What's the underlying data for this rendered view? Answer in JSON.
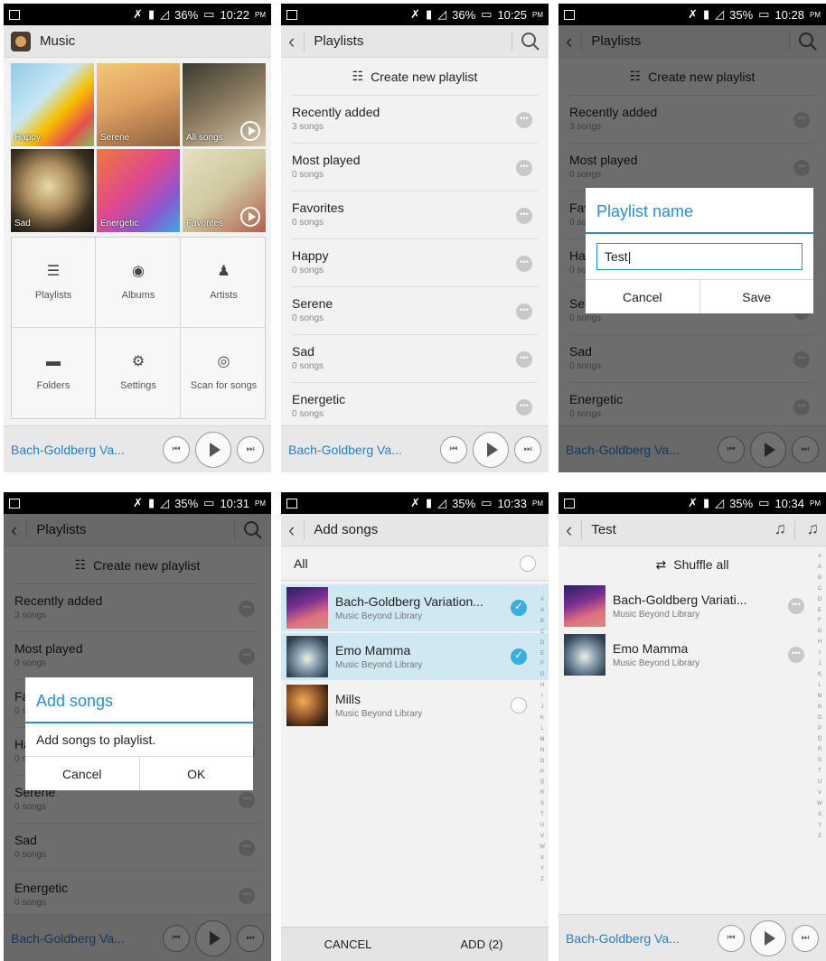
{
  "status": {
    "s1": {
      "battery": "36%",
      "time": "10:22",
      "ampm": "PM"
    },
    "s2": {
      "battery": "36%",
      "time": "10:25",
      "ampm": "PM"
    },
    "s3": {
      "battery": "35%",
      "time": "10:28",
      "ampm": "PM"
    },
    "s4": {
      "battery": "35%",
      "time": "10:31",
      "ampm": "PM"
    },
    "s5": {
      "battery": "35%",
      "time": "10:33",
      "ampm": "PM"
    },
    "s6": {
      "battery": "35%",
      "time": "10:34",
      "ampm": "PM"
    }
  },
  "home": {
    "title": "Music",
    "tiles": [
      "Happy",
      "Serene",
      "All songs",
      "Sad",
      "Energetic",
      "Favorites"
    ],
    "nav": [
      "Playlists",
      "Albums",
      "Artists",
      "Folders",
      "Settings",
      "Scan for songs"
    ]
  },
  "player": {
    "now_playing": "Bach-Goldberg Va..."
  },
  "playlists": {
    "title": "Playlists",
    "create": "Create new playlist",
    "items": [
      {
        "name": "Recently added",
        "count": "3 songs"
      },
      {
        "name": "Most played",
        "count": "0 songs"
      },
      {
        "name": "Favorites",
        "count": "0 songs"
      },
      {
        "name": "Happy",
        "count": "0 songs"
      },
      {
        "name": "Serene",
        "count": "0 songs"
      },
      {
        "name": "Sad",
        "count": "0 songs"
      },
      {
        "name": "Energetic",
        "count": "0 songs"
      }
    ]
  },
  "dialog_name": {
    "title": "Playlist name",
    "value": "Test",
    "cancel": "Cancel",
    "save": "Save"
  },
  "dialog_add": {
    "title": "Add songs",
    "body": "Add songs to playlist.",
    "cancel": "Cancel",
    "ok": "OK"
  },
  "add_songs": {
    "title": "Add songs",
    "all": "All",
    "songs": [
      {
        "title": "Bach-Goldberg Variation...",
        "artist": "Music Beyond Library",
        "selected": true
      },
      {
        "title": "Emo Mamma",
        "artist": "Music Beyond Library",
        "selected": true
      },
      {
        "title": "Mills",
        "artist": "Music Beyond Library",
        "selected": false
      }
    ],
    "cancel": "CANCEL",
    "add": "ADD (2)",
    "alphabet": [
      "#",
      "A",
      "B",
      "C",
      "D",
      "E",
      "F",
      "G",
      "H",
      "I",
      "J",
      "K",
      "L",
      "M",
      "N",
      "O",
      "P",
      "Q",
      "R",
      "S",
      "T",
      "U",
      "V",
      "W",
      "X",
      "Y",
      "Z"
    ]
  },
  "test_playlist": {
    "title": "Test",
    "shuffle": "Shuffle all",
    "songs": [
      {
        "title": "Bach-Goldberg Variati...",
        "artist": "Music Beyond Library"
      },
      {
        "title": "Emo Mamma",
        "artist": "Music Beyond Library"
      }
    ]
  },
  "colors": {
    "accent": "#2a8ed8",
    "selected_bg": "#cfe8f2",
    "check": "#3aaee0"
  }
}
